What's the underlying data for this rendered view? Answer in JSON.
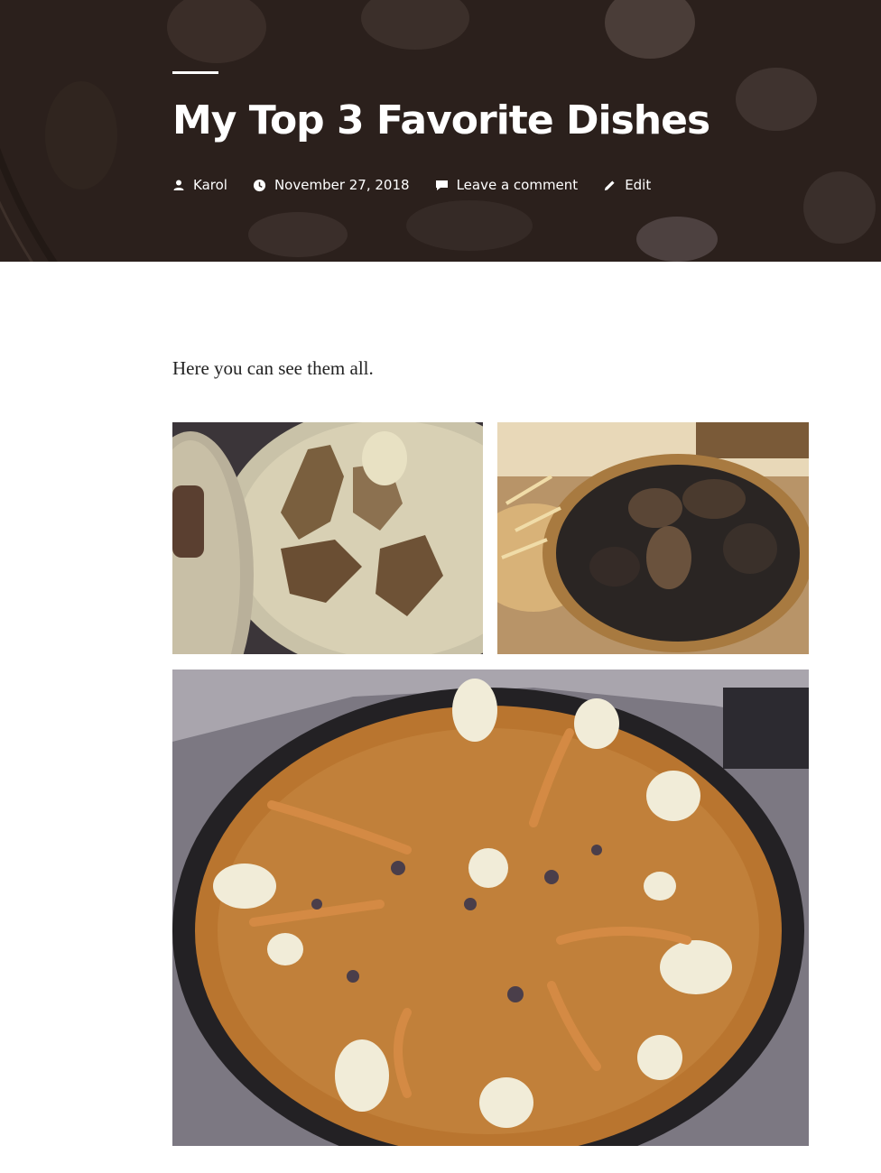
{
  "post": {
    "title": "My Top 3 Favorite Dishes",
    "meta": {
      "author": "Karol",
      "date": "November 27, 2018",
      "comments": "Leave a comment",
      "edit": "Edit"
    },
    "intro": "Here you can see them all."
  },
  "icons": {
    "author": "person-icon",
    "date": "clock-icon",
    "comments": "comment-icon",
    "edit": "pencil-icon"
  },
  "colors": {
    "hero_bg": "#2b201c",
    "text_white": "#ffffff",
    "body_text": "#222222"
  }
}
